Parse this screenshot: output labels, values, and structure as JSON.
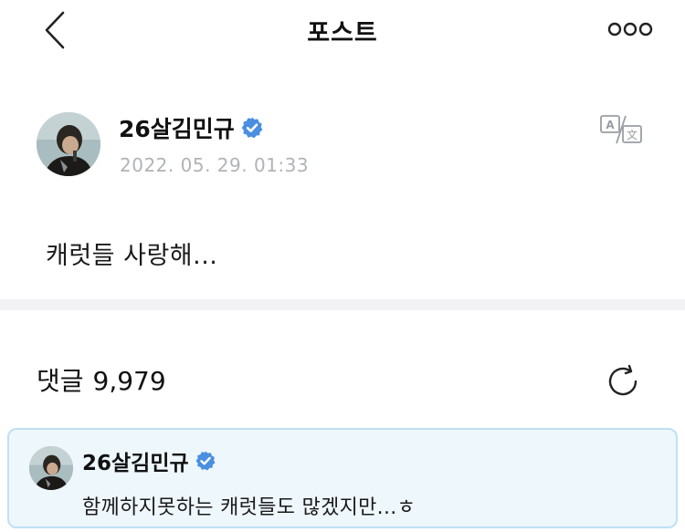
{
  "header": {
    "title": "포스트",
    "back_icon": "chevron-left-icon",
    "more_icon": "more-horizontal-icon"
  },
  "post": {
    "author_name": "26살김민규",
    "verified_icon": "verified-badge-icon",
    "verified_color": "#4a8fe0",
    "date": "2022. 05. 29. 01:33",
    "translate_icon": "translate-icon",
    "body": "캐럿들 사랑해..."
  },
  "comments": {
    "label": "댓글",
    "count": "9,979",
    "refresh_icon": "refresh-icon",
    "highlighted": {
      "author_name": "26살김민규",
      "text": "함께하지못하는 캐럿들도 많겠지만...ㅎ",
      "background": "#eef7fc",
      "border": "#bfe0f2"
    }
  }
}
